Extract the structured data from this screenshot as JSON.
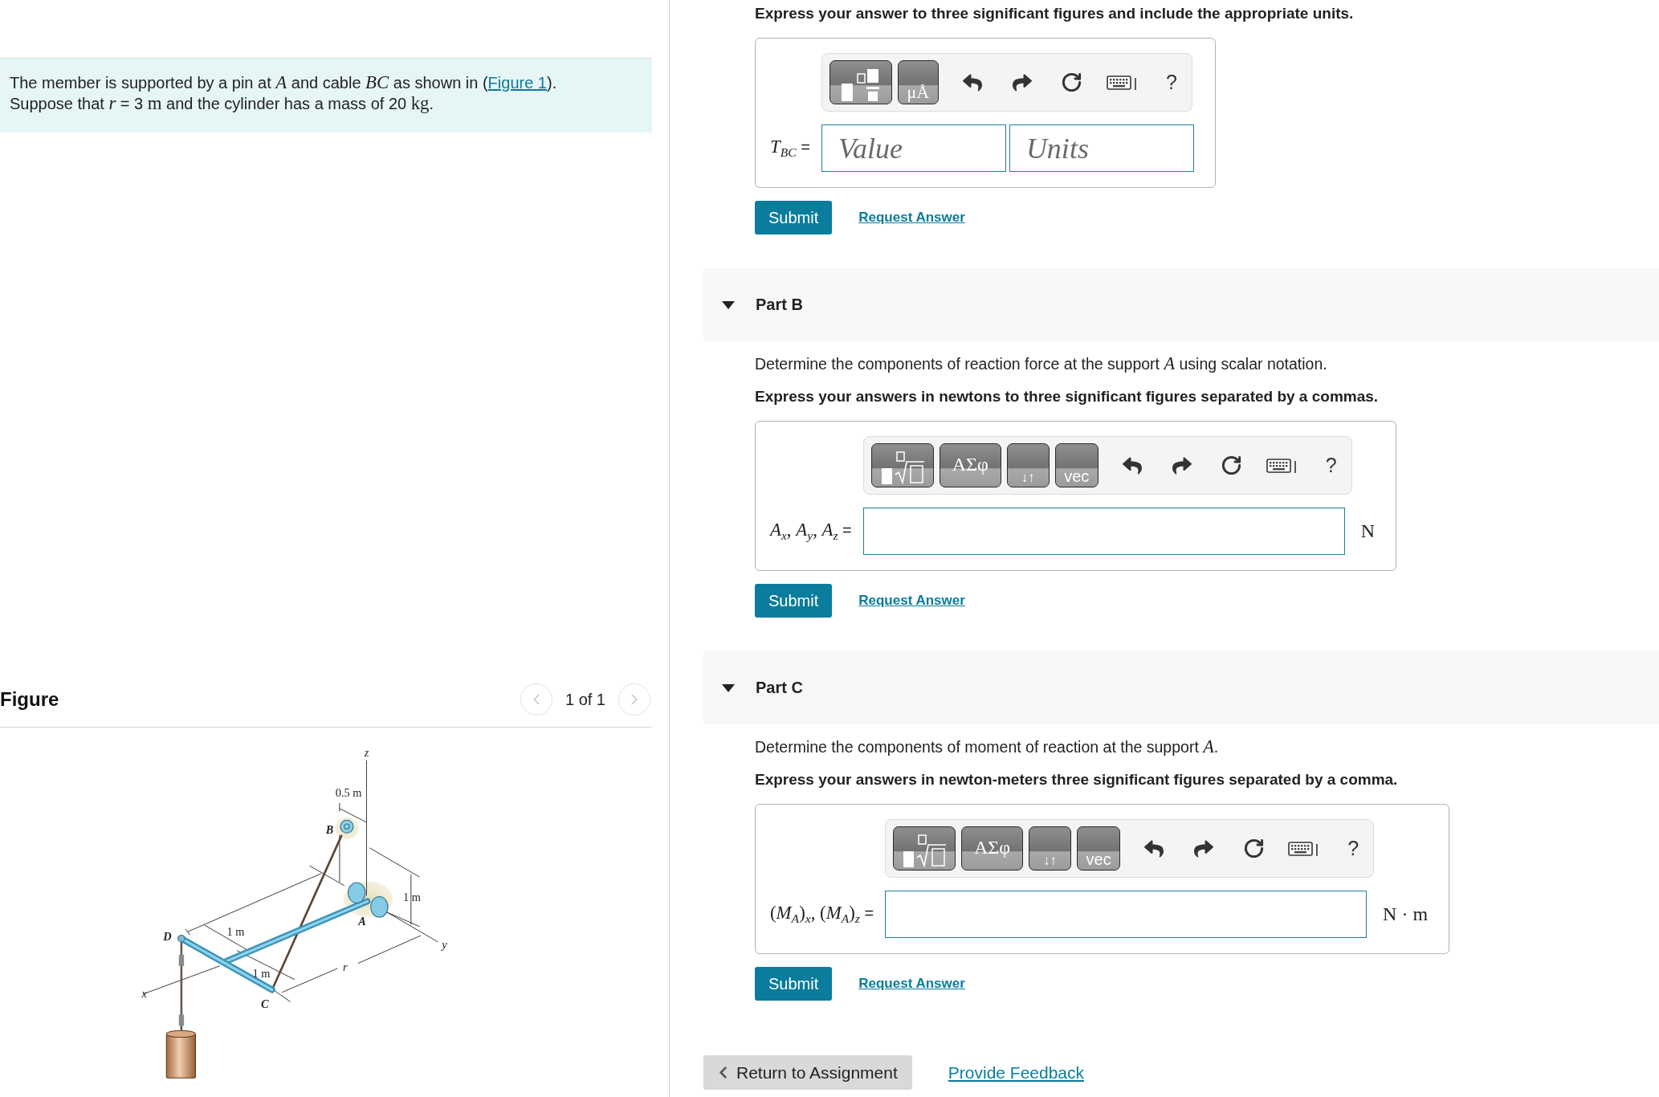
{
  "problem": {
    "lines": [
      [
        {
          "kind": "text",
          "text": "The member is supported by a pin at "
        },
        {
          "kind": "math",
          "text": "A"
        },
        {
          "kind": "text",
          "text": " and cable "
        },
        {
          "kind": "math",
          "text": "BC"
        },
        {
          "kind": "text",
          "text": " as shown in ("
        },
        {
          "kind": "link",
          "text": "Figure 1"
        },
        {
          "kind": "text",
          "text": ")."
        }
      ],
      [
        {
          "kind": "text",
          "text": "Suppose that "
        },
        {
          "kind": "math",
          "text": "r"
        },
        {
          "kind": "text",
          "text": " = 3 "
        },
        {
          "kind": "unit",
          "text": "m"
        },
        {
          "kind": "text",
          "text": " and the cylinder has a mass of 20 "
        },
        {
          "kind": "unit",
          "text": "kg"
        },
        {
          "kind": "text",
          "text": "."
        }
      ]
    ]
  },
  "figure": {
    "title": "Figure",
    "pager": {
      "label": "1 of 1",
      "prev_disabled": true,
      "next_disabled": true
    },
    "labels": [
      {
        "kind": "axis",
        "text": "z"
      },
      {
        "kind": "dimension",
        "text": "0.5 m"
      },
      {
        "kind": "point",
        "text": "B"
      },
      {
        "kind": "dimension",
        "text": "1 m"
      },
      {
        "kind": "point",
        "text": "A"
      },
      {
        "kind": "point",
        "text": "D"
      },
      {
        "kind": "dimension",
        "text": "1 m"
      },
      {
        "kind": "axis",
        "text": "y"
      },
      {
        "kind": "dimension",
        "text": "1 m"
      },
      {
        "kind": "axis",
        "text": "r"
      },
      {
        "kind": "axis",
        "text": "x"
      },
      {
        "kind": "point",
        "text": "C"
      }
    ]
  },
  "parts": [
    {
      "instruction": "Express your answer to three significant figures and include the appropriate units.",
      "answer": {
        "toolbar": [
          {
            "kind": "fraction"
          },
          {
            "kind": "units",
            "label": "μÅ"
          },
          {
            "kind": "undo"
          },
          {
            "kind": "redo"
          },
          {
            "kind": "reset"
          },
          {
            "kind": "keyboard"
          },
          {
            "kind": "help",
            "label": "?"
          }
        ],
        "label": [
          {
            "kind": "math",
            "text": "T"
          },
          {
            "kind": "sub",
            "text": "BC"
          },
          {
            "kind": "text",
            "text": " ="
          }
        ],
        "inputs": [
          {
            "kind": "value",
            "placeholder": "Value"
          },
          {
            "kind": "units",
            "placeholder": "Units"
          }
        ]
      },
      "submit": "Submit",
      "request": "Request Answer"
    },
    {
      "title": "Part B",
      "expanded": true,
      "prompt": [
        {
          "kind": "text",
          "text": "Determine the components of reaction force at the support "
        },
        {
          "kind": "math",
          "text": "A"
        },
        {
          "kind": "text",
          "text": " using scalar notation."
        }
      ],
      "instruction": "Express your answers in newtons to three significant figures separated by a commas.",
      "answer": {
        "toolbar": [
          {
            "kind": "root"
          },
          {
            "kind": "greek",
            "label": "ΑΣφ"
          },
          {
            "kind": "arrows",
            "label": "↓↑"
          },
          {
            "kind": "vector",
            "label": "vec"
          },
          {
            "kind": "undo"
          },
          {
            "kind": "redo"
          },
          {
            "kind": "reset"
          },
          {
            "kind": "keyboard"
          },
          {
            "kind": "help",
            "label": "?"
          }
        ],
        "label": [
          {
            "kind": "math",
            "text": "A"
          },
          {
            "kind": "sub",
            "text": "x"
          },
          {
            "kind": "unit",
            "text": ", "
          },
          {
            "kind": "math",
            "text": "A"
          },
          {
            "kind": "sub",
            "text": "y"
          },
          {
            "kind": "unit",
            "text": ", "
          },
          {
            "kind": "math",
            "text": "A"
          },
          {
            "kind": "sub",
            "text": "z"
          },
          {
            "kind": "text",
            "text": " ="
          }
        ],
        "inputs": [
          {
            "kind": "answer"
          }
        ],
        "unit": "N"
      },
      "submit": "Submit",
      "request": "Request Answer"
    },
    {
      "title": "Part C",
      "expanded": true,
      "prompt": [
        {
          "kind": "text",
          "text": "Determine the components of moment of reaction at the support "
        },
        {
          "kind": "math",
          "text": "A"
        },
        {
          "kind": "text",
          "text": "."
        }
      ],
      "instruction": "Express your answers in newton-meters three significant figures separated by a comma.",
      "answer": {
        "toolbar": [
          {
            "kind": "root"
          },
          {
            "kind": "greek",
            "label": "ΑΣφ"
          },
          {
            "kind": "arrows",
            "label": "↓↑"
          },
          {
            "kind": "vector",
            "label": "vec"
          },
          {
            "kind": "undo"
          },
          {
            "kind": "redo"
          },
          {
            "kind": "reset"
          },
          {
            "kind": "keyboard"
          },
          {
            "kind": "help",
            "label": "?"
          }
        ],
        "label": [
          {
            "kind": "unit",
            "text": "("
          },
          {
            "kind": "math",
            "text": "M"
          },
          {
            "kind": "sub",
            "text": "A"
          },
          {
            "kind": "unit",
            "text": ")"
          },
          {
            "kind": "sub",
            "text": "x"
          },
          {
            "kind": "unit",
            "text": ", ("
          },
          {
            "kind": "math",
            "text": "M"
          },
          {
            "kind": "sub",
            "text": "A"
          },
          {
            "kind": "unit",
            "text": ")"
          },
          {
            "kind": "sub",
            "text": "z"
          },
          {
            "kind": "text",
            "text": " ="
          }
        ],
        "inputs": [
          {
            "kind": "answer"
          }
        ],
        "unit": "N · m"
      },
      "submit": "Submit",
      "request": "Request Answer"
    }
  ],
  "footer": {
    "return": "Return to Assignment",
    "feedback": "Provide Feedback"
  }
}
